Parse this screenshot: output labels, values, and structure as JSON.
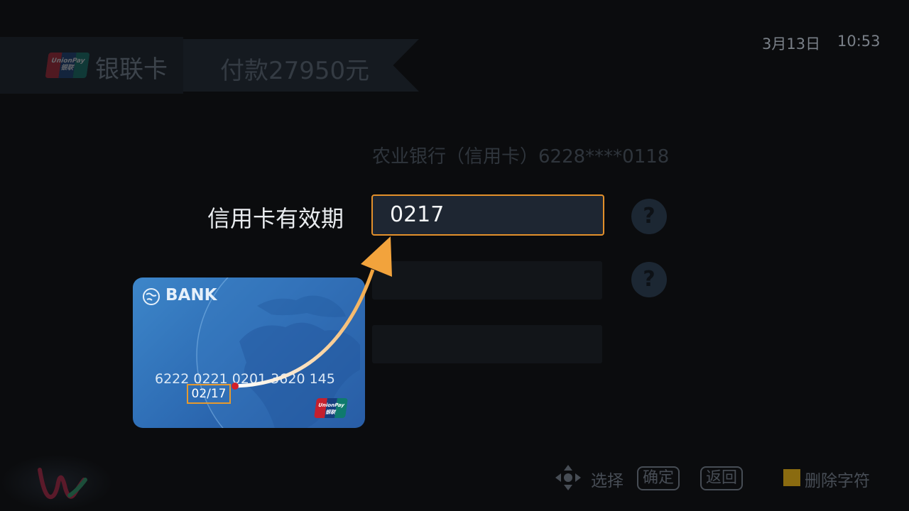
{
  "header": {
    "card_type": "银联卡",
    "unionpay_logo_text": "UnionPay 银联",
    "payment": "付款27950元",
    "date": "3月13日",
    "time": "10:53"
  },
  "form": {
    "bank_account": "农业银行（信用卡）6228****0118",
    "expiry_label": "信用卡有效期",
    "expiry_value": "0217",
    "help_symbol": "?"
  },
  "card_illustration": {
    "bank": "BANK",
    "number": "6222 0221 0201 3620 145",
    "expiry": "02/17",
    "logo_text": "UnionPay 银联"
  },
  "footer": {
    "select": "选择",
    "confirm": "确定",
    "back": "返回",
    "delete": "删除字符"
  },
  "colors": {
    "accent": "#e3902b",
    "background": "#0b0c0e",
    "input_bg": "#1e2632",
    "yellow_key": "#8a6b10"
  }
}
